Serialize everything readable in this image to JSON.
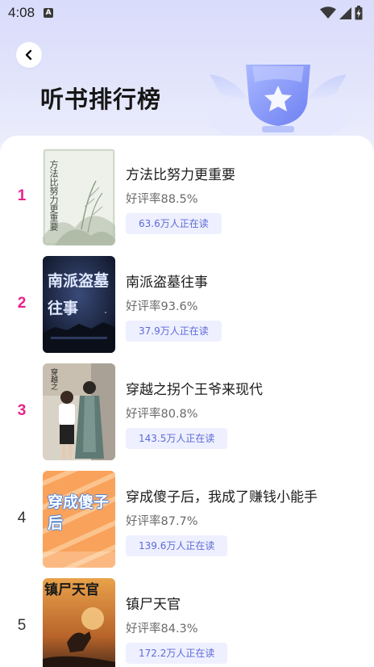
{
  "status_bar": {
    "time": "4:08",
    "notification_icon": "a-icon",
    "icons": [
      "wifi-icon",
      "signal-icon",
      "battery-charging-icon"
    ]
  },
  "header": {
    "back_icon": "chevron-left-icon",
    "title": "听书排行榜",
    "decoration": "trophy-star-icon"
  },
  "books": [
    {
      "rank": "1",
      "title": "方法比努力更重要",
      "rating": "好评率88.5%",
      "readers": "63.6万人正在读",
      "cover_text": "方法比努力更重要"
    },
    {
      "rank": "2",
      "title": "南派盗墓往事",
      "rating": "好评率93.6%",
      "readers": "37.9万人正在读",
      "cover_text": "南派盗墓往事"
    },
    {
      "rank": "3",
      "title": "穿越之拐个王爷来现代",
      "rating": "好评率80.8%",
      "readers": "143.5万人正在读",
      "cover_text": "穿越之"
    },
    {
      "rank": "4",
      "title": "穿成傻子后，我成了赚钱小能手",
      "rating": "好评率87.7%",
      "readers": "139.6万人正在读",
      "cover_text": "穿成傻子后"
    },
    {
      "rank": "5",
      "title": "镇尸天官",
      "rating": "好评率84.3%",
      "readers": "172.2万人正在读",
      "cover_text": "镇尸天官"
    }
  ],
  "colors": {
    "rank_top": "#e8228a",
    "rank_normal": "#333333",
    "badge_bg": "#eef0ff",
    "badge_text": "#5d6ad6",
    "header_bg": "#dcdffb"
  }
}
